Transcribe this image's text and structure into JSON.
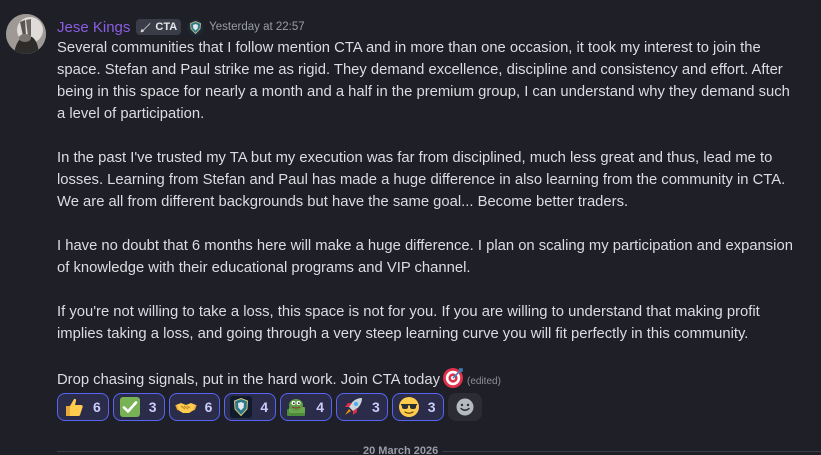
{
  "message": {
    "username": "Jese Kings",
    "tag": "CTA",
    "timestamp": "Yesterday at 22:57",
    "paragraphs": [
      "Several communities that I follow mention CTA and in more than one occasion, it took my interest to join the space. Stefan and Paul strike me as rigid. They demand excellence, discipline and consistency and effort. After being in this space for nearly a month and a half in the premium group, I can understand why they demand such a level of participation.",
      "In the past I've trusted my TA but my execution was far from disciplined, much less great and thus, lead me to losses. Learning from Stefan and Paul has made a huge difference in also learning from the community in CTA. We are all from different backgrounds but have the same goal... Become better traders.",
      "I have no doubt that 6 months here will make a huge difference. I plan on scaling my participation and expansion of knowledge with their educational programs and VIP channel.",
      "If you're not willing to take a loss, this space is not for you. If you are willing to understand that making profit implies taking a loss, and going through a very steep learning curve you will fit perfectly in this community."
    ],
    "last_line": "Drop chasing signals, put in the hard work. Join CTA today",
    "last_line_emoji": "direct-hit-target",
    "edited_label": "(edited)"
  },
  "reactions": [
    {
      "emoji": "thumbs-up",
      "count": "6"
    },
    {
      "emoji": "white-check-mark",
      "count": "3"
    },
    {
      "emoji": "handshake",
      "count": "6"
    },
    {
      "emoji": "cta-server-emblem",
      "count": "4"
    },
    {
      "emoji": "pepe-money",
      "count": "4"
    },
    {
      "emoji": "rocket",
      "count": "3"
    },
    {
      "emoji": "sunglasses-face",
      "count": "3"
    }
  ],
  "add_reaction_icon": "add-reaction-smiley",
  "date_divider": "20 March 2026",
  "colors": {
    "background": "#1e1f27",
    "username": "#8a5ee0",
    "reaction_border": "#5865f2",
    "reaction_bg": "#2a2c49",
    "text": "#dcdde0",
    "muted": "#9a9ca6"
  }
}
